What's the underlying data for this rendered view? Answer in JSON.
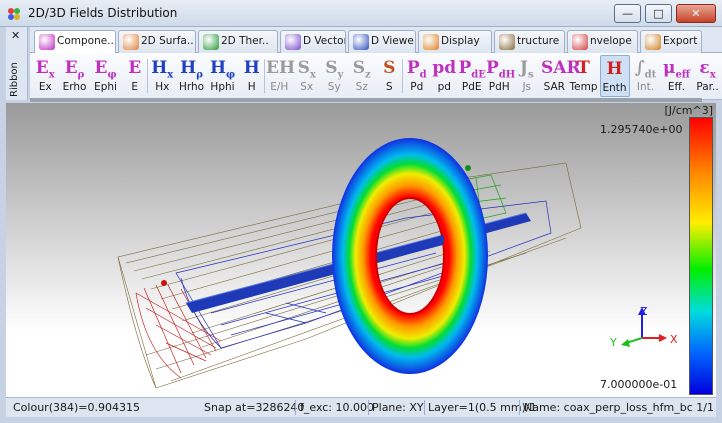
{
  "window": {
    "title": "2D/3D Fields Distribution",
    "minimize_label": "—",
    "maximize_label": "□",
    "close_label": "✕"
  },
  "ribbon": {
    "close_label": "✕",
    "side_label": "Ribbon"
  },
  "tabs": [
    {
      "label": "Compone..",
      "icon": "component-icon",
      "color": "#c02cc0",
      "active": true
    },
    {
      "label": "2D Surfa..",
      "icon": "surface-plot-icon",
      "color": "#e0803a"
    },
    {
      "label": "2D Ther..",
      "icon": "thermal-plot-icon",
      "color": "#2a9a3a"
    },
    {
      "label": "D Vector",
      "icon": "vector-plot-icon",
      "color": "#7a4ad0"
    },
    {
      "label": "D Viewe",
      "icon": "viewer-icon",
      "color": "#3050c0"
    },
    {
      "label": "Display",
      "icon": "display-icon",
      "color": "#e08020"
    },
    {
      "label": "tructure",
      "icon": "structure-icon",
      "color": "#8a6a3a"
    },
    {
      "label": "nvelope",
      "icon": "envelope-icon",
      "color": "#d04040"
    },
    {
      "label": "Export",
      "icon": "export-icon",
      "color": "#d08020"
    }
  ],
  "tools": [
    {
      "glyph": "E",
      "sub": "x",
      "label": "Ex",
      "color": "#c030c0"
    },
    {
      "glyph": "E",
      "sub": "ρ",
      "label": "Erho",
      "color": "#c030c0"
    },
    {
      "glyph": "E",
      "sub": "φ",
      "label": "Ephi",
      "color": "#c030c0"
    },
    {
      "glyph": "E",
      "sub": "",
      "label": "E",
      "color": "#c030c0"
    },
    {
      "glyph": "H",
      "sub": "x",
      "label": "Hx",
      "color": "#2040c0"
    },
    {
      "glyph": "H",
      "sub": "ρ",
      "label": "Hrho",
      "color": "#2040c0"
    },
    {
      "glyph": "H",
      "sub": "φ",
      "label": "Hphi",
      "color": "#2040c0"
    },
    {
      "glyph": "H",
      "sub": "",
      "label": "H",
      "color": "#2040c0"
    },
    {
      "glyph": "EH",
      "sub": "",
      "label": "E/H",
      "color": "#9a9a9a",
      "disabled": true,
      "dropdown": true
    },
    {
      "glyph": "S",
      "sub": "x",
      "label": "Sx",
      "color": "#9a9a9a",
      "disabled": true
    },
    {
      "glyph": "S",
      "sub": "y",
      "label": "Sy",
      "color": "#9a9a9a",
      "disabled": true
    },
    {
      "glyph": "S",
      "sub": "z",
      "label": "Sz",
      "color": "#9a9a9a",
      "disabled": true
    },
    {
      "glyph": "S",
      "sub": "",
      "label": "S",
      "color": "#c05020"
    },
    {
      "glyph": "P",
      "sub": "d",
      "label": "Pd",
      "color": "#c030c0"
    },
    {
      "glyph": "pd",
      "sub": "",
      "label": "pd",
      "color": "#c030c0"
    },
    {
      "glyph": "P",
      "sub": "dE",
      "label": "PdE",
      "color": "#c030c0"
    },
    {
      "glyph": "P",
      "sub": "dH",
      "label": "PdH",
      "color": "#c030c0"
    },
    {
      "glyph": "J",
      "sub": "s",
      "label": "Js",
      "color": "#9a9a9a",
      "disabled": true
    },
    {
      "glyph": "SAR",
      "sub": "",
      "label": "SAR",
      "color": "#c030c0"
    },
    {
      "glyph": "T",
      "sub": "",
      "label": "Temp",
      "color": "#d02020"
    },
    {
      "glyph": "H",
      "sub": "",
      "label": "Enth",
      "color": "#d02020",
      "selected": true
    },
    {
      "glyph": "∫",
      "sub": "dt",
      "label": "Int.",
      "color": "#9a9a9a",
      "disabled": true
    },
    {
      "glyph": "μ",
      "sub": "eff",
      "label": "Eff.",
      "color": "#c030c0"
    },
    {
      "glyph": "ε",
      "sub": "x",
      "label": "Par..",
      "color": "#c030c0",
      "dropdown": true
    }
  ],
  "viewport": {
    "unit": "[J/cm^3]",
    "colorbar_max": "1.295740e+00",
    "colorbar_min": "7.000000e-01",
    "axis_x": "X",
    "axis_y": "Y",
    "axis_z": "Z",
    "colors": {
      "x_axis": "#e02020",
      "y_axis": "#20c020",
      "z_axis": "#2020e0"
    }
  },
  "status": {
    "colour": "Colour(384)=0.904315",
    "snap": "Snap at=3286240",
    "freq": "f_exc: 10.000",
    "plane": "Plane: XY",
    "layer": "Layer=1(0.5 mm)/1",
    "name": "Name: coax_perp_loss_hfm_bc 1/1"
  }
}
